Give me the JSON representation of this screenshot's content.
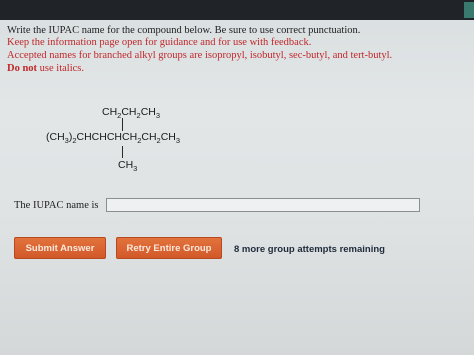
{
  "question": {
    "line1": "Write the IUPAC name for the compound below. Be sure to use correct punctuation.",
    "line2": "Keep the information page open for guidance and for use with feedback.",
    "line3": "Accepted names for branched alkyl groups are isopropyl, isobutyl, sec-butyl, and tert-butyl.",
    "line4_bold": "Do not",
    "line4_rest": " use italics."
  },
  "structure": {
    "top_branch": [
      "CH",
      "2",
      "CH",
      "2",
      "CH",
      "3"
    ],
    "main_chain": [
      "(CH",
      "3",
      ")",
      "2",
      "CHCHCHCH",
      "2",
      "CH",
      "2",
      "CH",
      "3"
    ],
    "bottom_branch": [
      "CH",
      "3"
    ]
  },
  "answer": {
    "label": "The IUPAC name is",
    "value": "",
    "placeholder": ""
  },
  "buttons": {
    "submit": "Submit Answer",
    "retry": "Retry Entire Group"
  },
  "status": {
    "attempts": "8 more group attempts remaining"
  },
  "colors": {
    "instruction_red": "#c0282a",
    "button_orange": "#d8602f"
  }
}
